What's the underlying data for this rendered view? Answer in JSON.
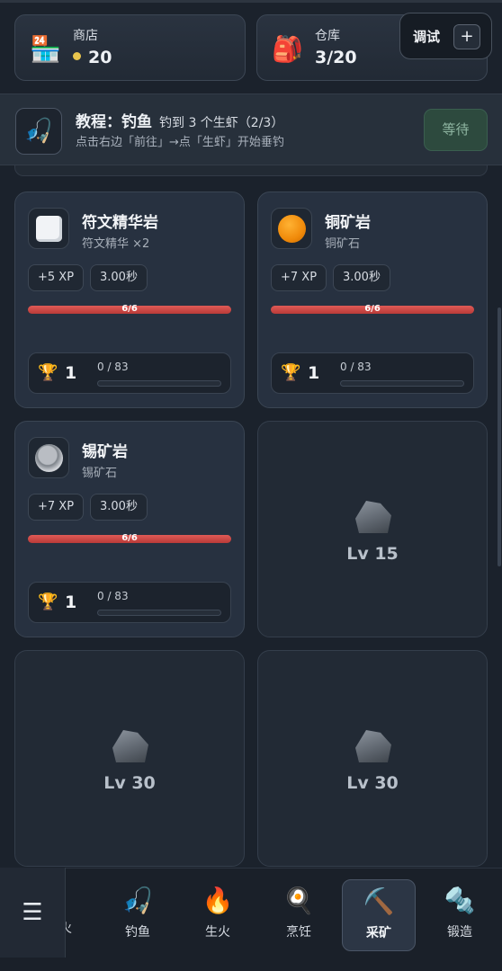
{
  "header": {
    "shop": {
      "label": "商店",
      "coins": "20",
      "icon": "store-icon"
    },
    "warehouse": {
      "label": "仓库",
      "capacity": "3/20",
      "icon": "backpack-icon"
    },
    "debug": {
      "label": "调试",
      "plus": "+"
    }
  },
  "tutorial": {
    "title": "教程：钓鱼",
    "goal": "钓到 3 个生虾（2/3）",
    "description": "点击右边「前往」→点「生虾」开始垂钓",
    "button": "等待",
    "icon": "fishing-rod-icon"
  },
  "ores": [
    {
      "name": "符文精华岩",
      "yield": "符文精华 ×2",
      "xp": "+5 XP",
      "time": "3.00秒",
      "health": "6/6",
      "level": "1",
      "progress": "0 / 83",
      "progress_fraction": 0
    },
    {
      "name": "铜矿岩",
      "yield": "铜矿石",
      "xp": "+7 XP",
      "time": "3.00秒",
      "health": "6/6",
      "level": "1",
      "progress": "0 / 83",
      "progress_fraction": 0
    },
    {
      "name": "锡矿岩",
      "yield": "锡矿石",
      "xp": "+7 XP",
      "time": "3.00秒",
      "health": "6/6",
      "level": "1",
      "progress": "0 / 83",
      "progress_fraction": 0
    }
  ],
  "locked": [
    {
      "level": "Lv 15"
    },
    {
      "level": "Lv 30"
    },
    {
      "level": "Lv 30"
    }
  ],
  "nav": {
    "menu": "☰",
    "partial": "火",
    "items": [
      {
        "label": "钓鱼",
        "icon": "fishing-rod-icon"
      },
      {
        "label": "生火",
        "icon": "fire-icon"
      },
      {
        "label": "烹饪",
        "icon": "frying-pan-icon"
      },
      {
        "label": "采矿",
        "icon": "pickaxe-icon"
      },
      {
        "label": "锻造",
        "icon": "anvil-icon"
      }
    ],
    "active": "采矿"
  },
  "colors": {
    "accent_gold": "#f1cd57",
    "health_red": "#d04a47",
    "wait_green": "#2d4a3e"
  }
}
